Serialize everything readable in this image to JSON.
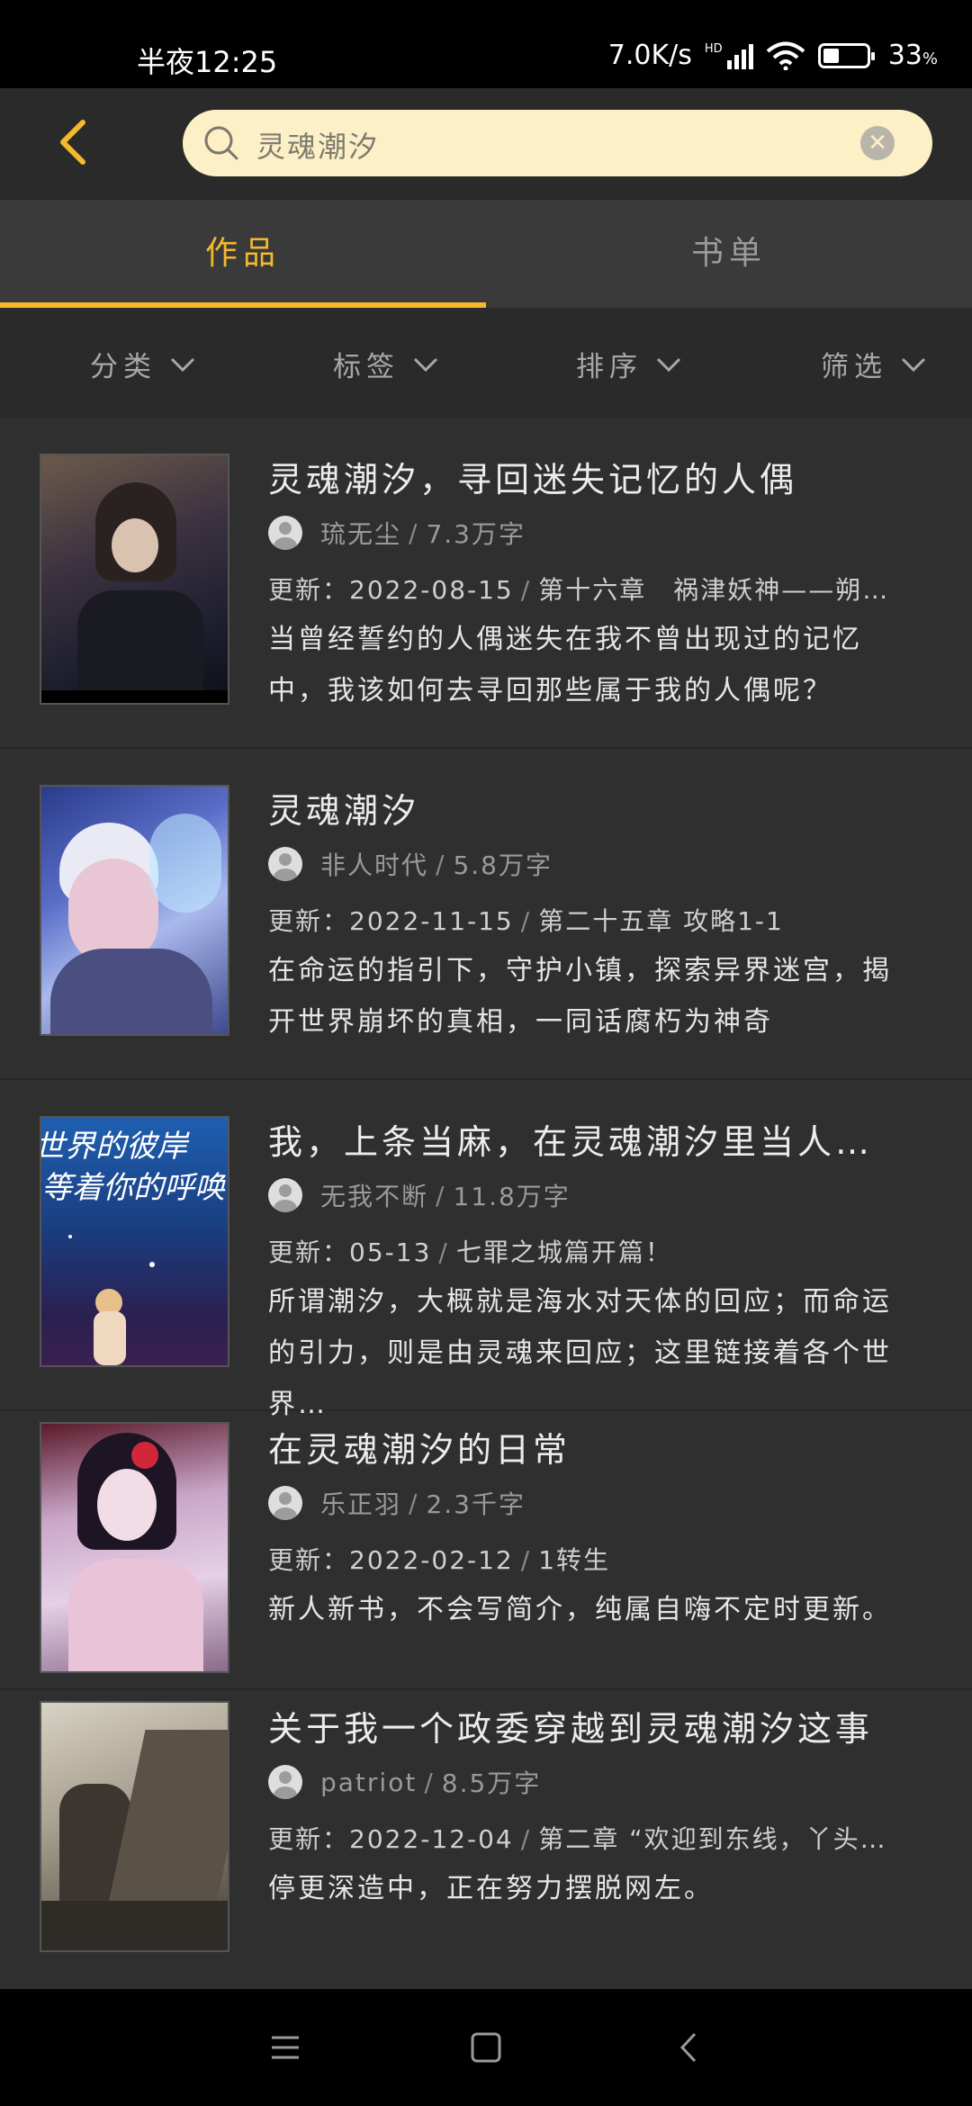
{
  "status_bar": {
    "time": "半夜12:25",
    "net_speed": "7.0K/s",
    "hd": "HD",
    "battery": "33"
  },
  "header": {
    "search_value": "灵魂潮汐"
  },
  "tabs": [
    {
      "label": "作品"
    },
    {
      "label": "书单"
    }
  ],
  "filters": [
    {
      "label": "分类"
    },
    {
      "label": "标签"
    },
    {
      "label": "排序"
    },
    {
      "label": "筛选"
    }
  ],
  "books": [
    {
      "title": "灵魂潮汐，寻回迷失记忆的人偶",
      "author": "琉无尘",
      "words": "7.3万字",
      "update_prefix": "更新：",
      "update_date": "2022-08-15",
      "update_chapter": "第十六章　祸津妖神——朔…",
      "desc": "当曾经誓约的人偶迷失在我不曾出现过的记忆中，我该如何去寻回那些属于我的人偶呢？"
    },
    {
      "title": "灵魂潮汐",
      "author": "非人时代",
      "words": "5.8万字",
      "update_prefix": "更新：",
      "update_date": "2022-11-15",
      "update_chapter": "第二十五章 攻略1-1",
      "desc": "在命运的指引下，守护小镇，探索异界迷宫，揭开世界崩坏的真相，一同话腐朽为神奇"
    },
    {
      "title": "我，上条当麻，在灵魂潮汐里当人…",
      "author": "无我不断",
      "words": "11.8万字",
      "update_prefix": "更新：",
      "update_date": "05-13",
      "update_chapter": "七罪之城篇开篇！",
      "desc": "所谓潮汐，大概就是海水对天体的回应；而命运的引力，则是由灵魂来回应；这里链接着各个世界…",
      "cover_text_1": "世界的彼岸",
      "cover_text_2": "等着你的呼唤"
    },
    {
      "title": "在灵魂潮汐的日常",
      "author": "乐正羽",
      "words": "2.3千字",
      "update_prefix": "更新：",
      "update_date": "2022-02-12",
      "update_chapter": "1转生",
      "desc": "新人新书，不会写简介，纯属自嗨不定时更新。"
    },
    {
      "title": "关于我一个政委穿越到灵魂潮汐这事",
      "author": "patriot",
      "words": "8.5万字",
      "update_prefix": "更新：",
      "update_date": "2022-12-04",
      "update_chapter": "第二章 “欢迎到东线，丫头…",
      "desc": "停更深造中，正在努力摆脱网左。"
    }
  ],
  "colors": {
    "accent": "#f5b82e",
    "search_bg": "#fdf0c6",
    "bg": "#2f2f2f"
  }
}
